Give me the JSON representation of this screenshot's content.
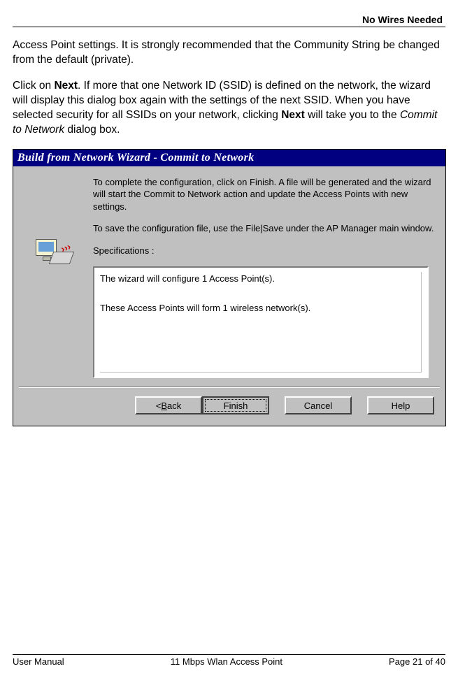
{
  "header": {
    "brand": "No Wires Needed"
  },
  "body": {
    "para1": "Access Point settings. It is strongly recommended that the Community String be changed from the default (private).",
    "para2_a": "Click on ",
    "para2_bold1": "Next",
    "para2_b": ". If more that one Network ID (SSID) is defined on the network, the wizard will display this dialog box again with the settings of the next SSID. When you have selected security for all SSIDs on your network, clicking ",
    "para2_bold2": "Next",
    "para2_c": " will take you to the ",
    "para2_italic": "Commit to Network",
    "para2_d": " dialog box."
  },
  "wizard": {
    "title": "Build from Network Wizard - Commit to Network",
    "p1": "To complete the configuration, click on Finish. A file will be generated and the wizard will start the Commit to Network action and update the Access Points with new settings.",
    "p2": "To save the configuration file, use the File|Save under the AP Manager main window.",
    "spec_label": "Specifications :",
    "spec_line1": "The wizard will configure 1 Access Point(s).",
    "spec_line2": "These Access Points will form 1 wireless network(s).",
    "buttons": {
      "back_pre": "< ",
      "back_u": "B",
      "back_post": "ack",
      "finish": "Finish",
      "cancel": "Cancel",
      "help": "Help"
    }
  },
  "footer": {
    "left": "User Manual",
    "center": "11 Mbps Wlan Access Point",
    "right": "Page 21 of 40"
  }
}
